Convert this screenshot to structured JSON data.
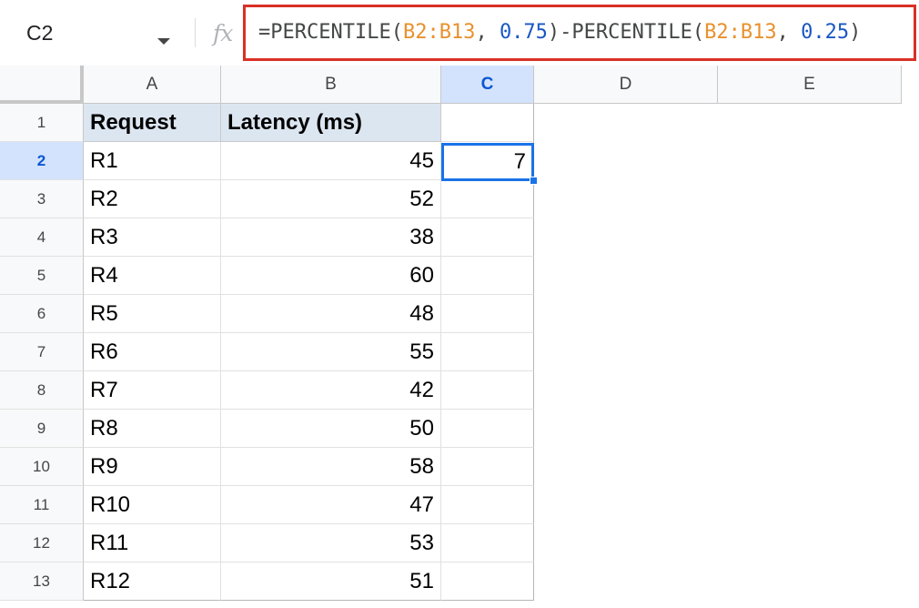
{
  "name_box": {
    "value": "C2"
  },
  "formula_bar": {
    "tokens": [
      {
        "text": "=PERCENTILE(",
        "kind": "plain"
      },
      {
        "text": "B2:B13",
        "kind": "ref"
      },
      {
        "text": ", ",
        "kind": "plain"
      },
      {
        "text": "0.75",
        "kind": "num"
      },
      {
        "text": ")-PERCENTILE(",
        "kind": "plain"
      },
      {
        "text": "B2:B13",
        "kind": "ref"
      },
      {
        "text": ", ",
        "kind": "plain"
      },
      {
        "text": "0.25",
        "kind": "num"
      },
      {
        "text": ")",
        "kind": "plain"
      }
    ]
  },
  "columns": [
    "A",
    "B",
    "C",
    "D",
    "E"
  ],
  "selected_column": "C",
  "selected_row": "2",
  "rows": [
    {
      "num": "1",
      "a": "Request",
      "b": "Latency (ms)",
      "c": ""
    },
    {
      "num": "2",
      "a": "R1",
      "b": "45",
      "c": "7"
    },
    {
      "num": "3",
      "a": "R2",
      "b": "52",
      "c": ""
    },
    {
      "num": "4",
      "a": "R3",
      "b": "38",
      "c": ""
    },
    {
      "num": "5",
      "a": "R4",
      "b": "60",
      "c": ""
    },
    {
      "num": "6",
      "a": "R5",
      "b": "48",
      "c": ""
    },
    {
      "num": "7",
      "a": "R6",
      "b": "55",
      "c": ""
    },
    {
      "num": "8",
      "a": "R7",
      "b": "42",
      "c": ""
    },
    {
      "num": "9",
      "a": "R8",
      "b": "50",
      "c": ""
    },
    {
      "num": "10",
      "a": "R9",
      "b": "58",
      "c": ""
    },
    {
      "num": "11",
      "a": "R10",
      "b": "47",
      "c": ""
    },
    {
      "num": "12",
      "a": "R11",
      "b": "53",
      "c": ""
    },
    {
      "num": "13",
      "a": "R12",
      "b": "51",
      "c": ""
    }
  ],
  "colors": {
    "formula_highlight_border": "#d93025",
    "selection_blue": "#1a73e8",
    "header_fill": "#dce6f1",
    "reference_orange": "#e8912d",
    "number_blue": "#1a57c4"
  },
  "icons": {
    "formula": "fx-icon",
    "name_box_dropdown": "chevron-down-icon"
  }
}
